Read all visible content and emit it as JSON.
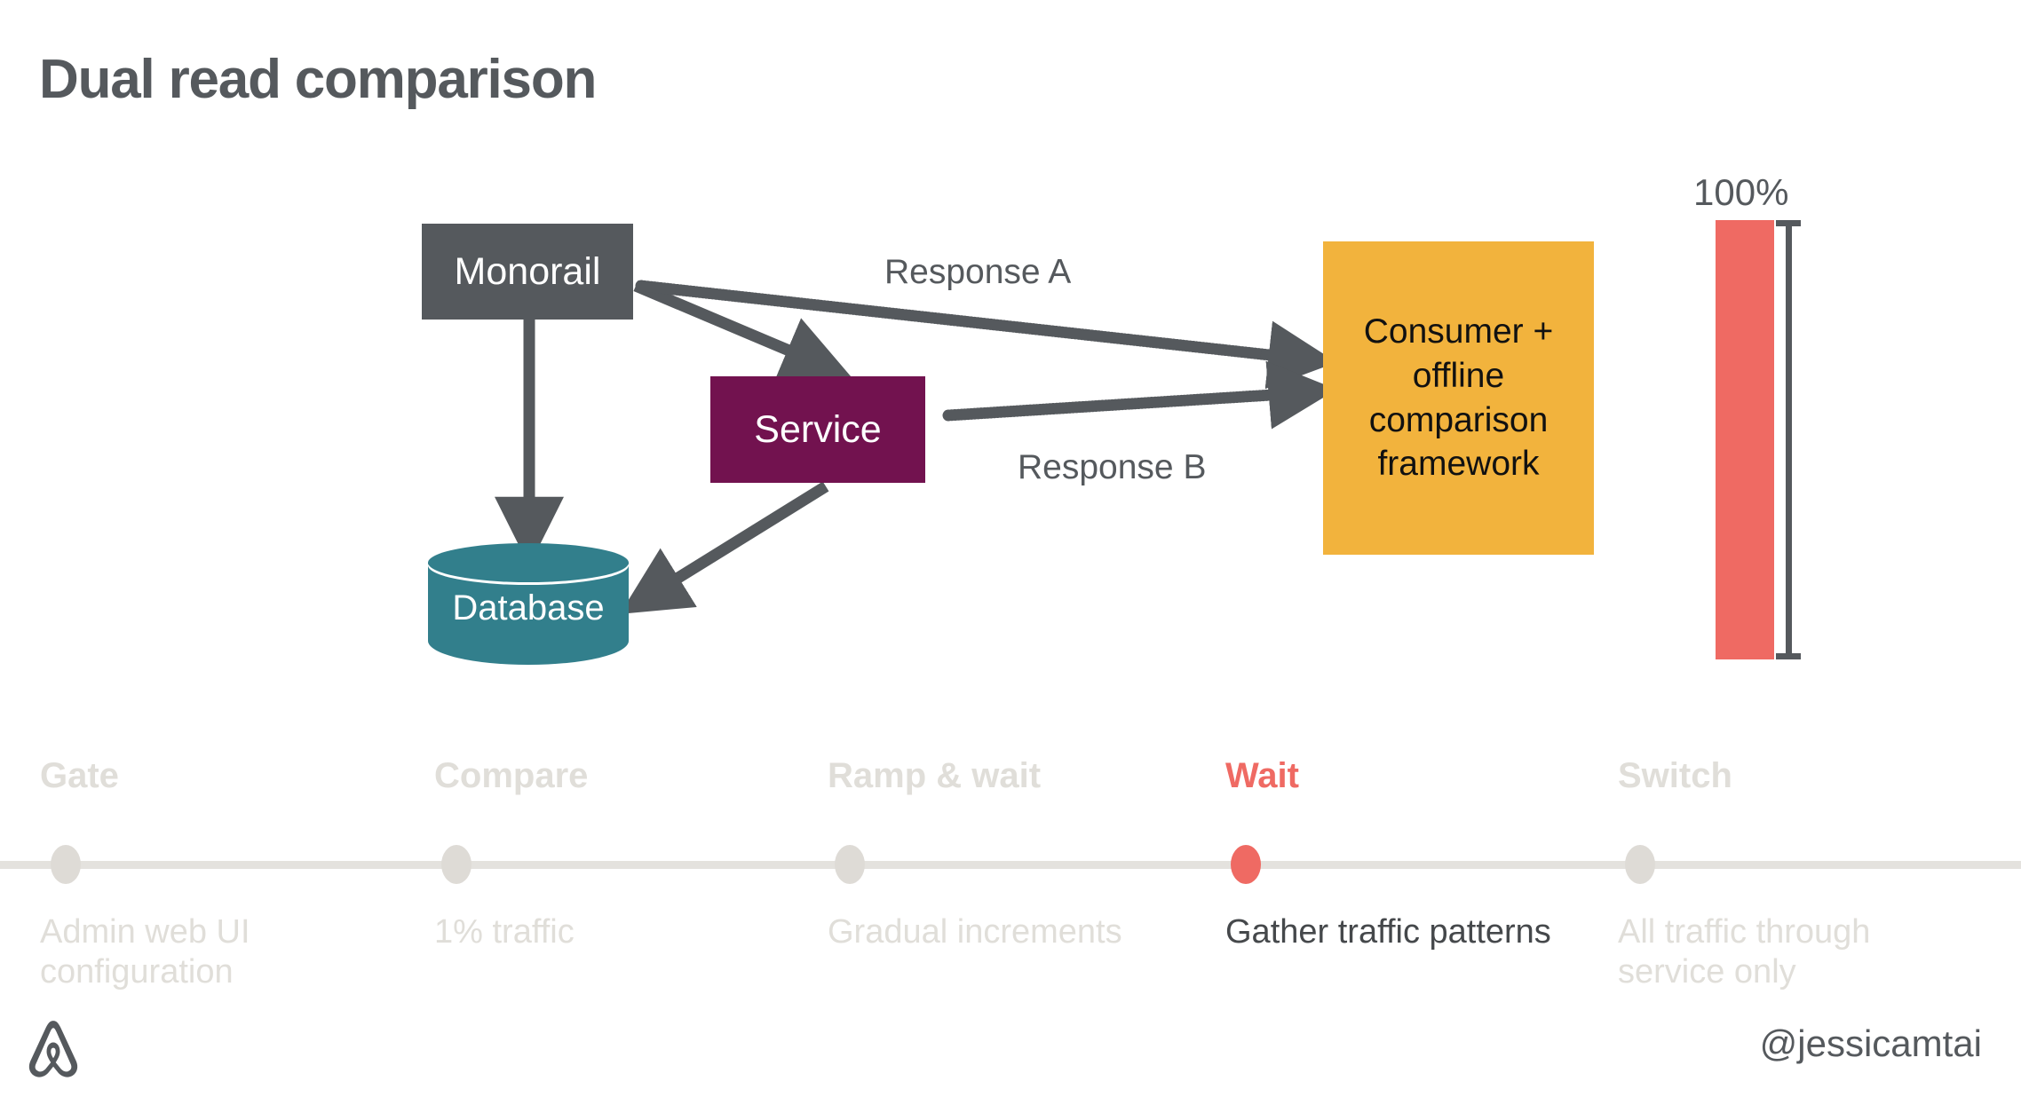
{
  "slide": {
    "title": "Dual read comparison",
    "background_color": "#ffffff"
  },
  "colors": {
    "title_gray": "#55595d",
    "monorail_gray": "#55595d",
    "service_purple": "#72124f",
    "database_teal": "#327f8c",
    "consumer_yellow": "#f2b33d",
    "bar_red": "#ef6a63",
    "arrow_gray": "#55595d",
    "timeline_inactive": "#e0ded9",
    "timeline_rail": "#e4e2de",
    "timeline_active": "#ef6a63",
    "timeline_active_desc": "#45484b"
  },
  "diagram": {
    "nodes": [
      {
        "id": "monorail",
        "label": "Monorail",
        "shape": "rect",
        "fill": "#55595d",
        "text_color": "#ffffff"
      },
      {
        "id": "service",
        "label": "Service",
        "shape": "rect",
        "fill": "#72124f",
        "text_color": "#ffffff"
      },
      {
        "id": "database",
        "label": "Database",
        "shape": "cylinder",
        "fill": "#327f8c",
        "text_color": "#ffffff"
      },
      {
        "id": "consumer",
        "label": "Consumer + offline comparison framework",
        "shape": "rect",
        "fill": "#f2b33d",
        "text_color": "#111111"
      }
    ],
    "consumer_lines": [
      "Consumer +",
      "offline",
      "comparison",
      "framework"
    ],
    "edges": [
      {
        "from": "monorail",
        "to": "database",
        "style": "solid",
        "label": ""
      },
      {
        "from": "monorail",
        "to": "service",
        "style": "solid",
        "label": ""
      },
      {
        "from": "service",
        "to": "database",
        "style": "solid",
        "label": ""
      },
      {
        "from": "monorail",
        "to": "consumer",
        "style": "dotted",
        "label": "Response A"
      },
      {
        "from": "service",
        "to": "consumer",
        "style": "dotted",
        "label": "Response B"
      }
    ],
    "edge_labels": {
      "response_a": "Response A",
      "response_b": "Response B"
    }
  },
  "traffic_meter": {
    "percent_label": "100%",
    "value": 100,
    "bar_color": "#ef6a63",
    "bracket_color": "#55595d"
  },
  "timeline": {
    "active_index": 3,
    "steps": [
      {
        "title": "Gate",
        "description": "Admin web UI configuration",
        "active": false
      },
      {
        "title": "Compare",
        "description": "1% traffic",
        "active": false
      },
      {
        "title": "Ramp & wait",
        "description": "Gradual increments",
        "active": false
      },
      {
        "title": "Wait",
        "description": "Gather traffic patterns",
        "active": true
      },
      {
        "title": "Switch",
        "description": "All traffic through service only",
        "active": false
      }
    ]
  },
  "footer": {
    "logo_name": "airbnb-logo",
    "handle": "@jessicamtai"
  }
}
